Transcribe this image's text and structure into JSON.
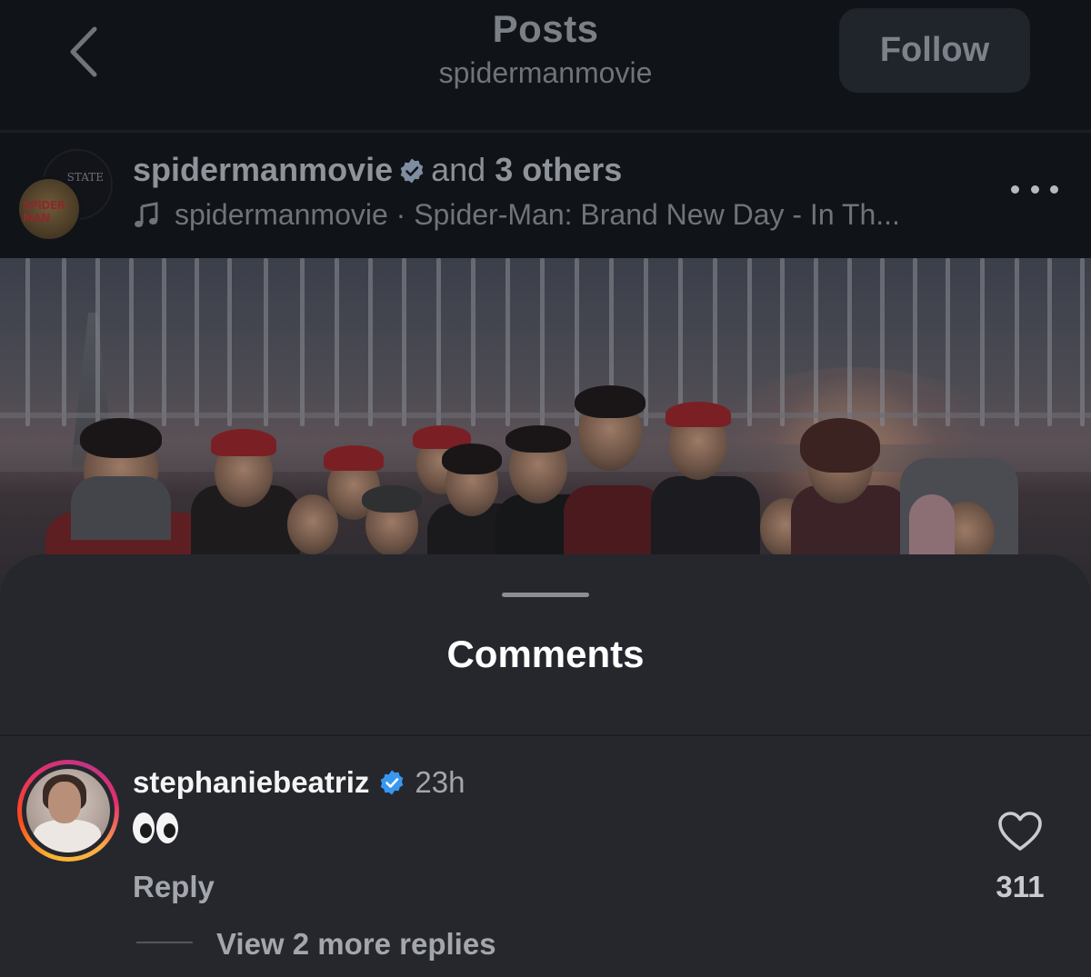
{
  "header": {
    "title": "Posts",
    "subtitle": "spidermanmovie",
    "follow_label": "Follow"
  },
  "post": {
    "username": "spidermanmovie",
    "collab_text": "and",
    "collab_others": "3 others",
    "audio_text": "spidermanmovie · Spider-Man: Brand New Day - In Th...",
    "avatar_back_text": "STATE",
    "avatar_front_text": "SPIDER-MAN"
  },
  "comments_sheet": {
    "title": "Comments",
    "items": [
      {
        "username": "stephaniebeatriz",
        "time": "23h",
        "text": "👀",
        "reply_label": "Reply",
        "like_count": "311",
        "view_replies_label": "View 2 more replies"
      }
    ]
  },
  "icons": {
    "back": "chevron-left-icon",
    "verified": "verified-badge-icon",
    "music": "music-note-icon",
    "more": "more-horizontal-icon",
    "like": "heart-outline-icon"
  },
  "colors": {
    "verified_blue": "#3897f0",
    "sheet_bg": "#25272d",
    "dim_bg": "#101317"
  }
}
